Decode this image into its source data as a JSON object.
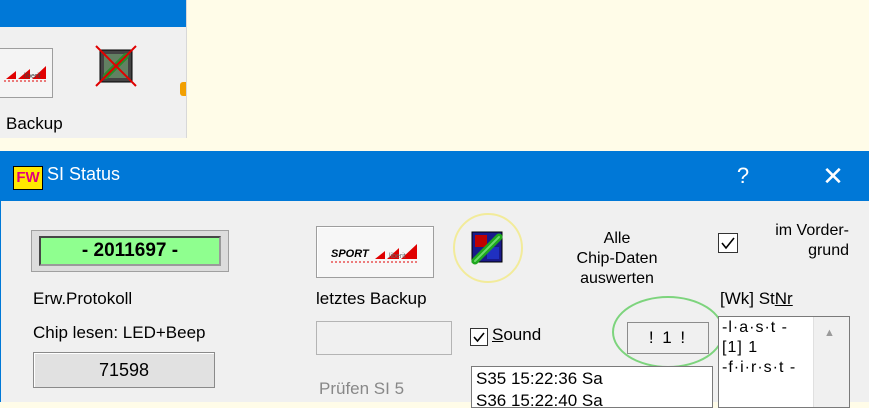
{
  "top_window": {
    "backup_label": "Backup",
    "icons": [
      "sport-logo-icon",
      "no-data-icon"
    ]
  },
  "window": {
    "title": "SI Status",
    "app_icon_text": "FW",
    "help_button": "?",
    "close_button": "✕"
  },
  "left_panel": {
    "chip_number": "- 2011697 -",
    "erw_protokoll": "Erw.Protokoll",
    "chip_lesen": "Chip lesen: LED+Beep",
    "count_button": "71598"
  },
  "middle_panel": {
    "letztes_backup": "letztes Backup",
    "backup_value": "",
    "pruefen": "Prüfen SI 5",
    "sport_button_icon": "sport-logo-icon",
    "chip_data_icon": "chip-data-icon"
  },
  "evaluate": {
    "line1": "Alle",
    "line2": "Chip-Daten",
    "line3": "auswerten"
  },
  "sound": {
    "label_first": "S",
    "label_rest": "ound",
    "checked": true
  },
  "indicator": "! 1 !",
  "log_list": {
    "lines": [
      "S35    15:22:36 Sa",
      "S36    15:22:40 Sa"
    ]
  },
  "right_panel": {
    "vordergrund_line1": "im Vorder-",
    "vordergrund_line2": "grund",
    "vordergrund_checked": true,
    "wk_label": "[Wk]  St",
    "nr_label": "Nr",
    "rank_lines": [
      "-l·a·s·t -",
      "[1]  1",
      "-f·i·r·s·t -"
    ]
  },
  "colors": {
    "titlebar": "#0078d7",
    "chip_field": "#8fff8f",
    "page_background": "#fffce8",
    "yellow_ring": "#f2eb9a",
    "green_ring": "#7dd47d"
  }
}
